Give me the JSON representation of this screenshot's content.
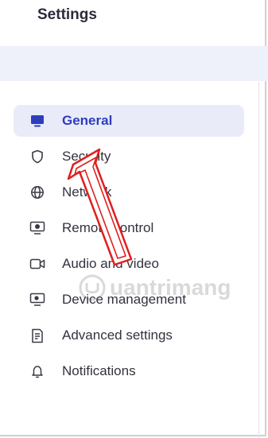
{
  "header": {
    "title": "Settings"
  },
  "sidebar": {
    "items": [
      {
        "label": "General",
        "icon": "monitor-icon",
        "active": true
      },
      {
        "label": "Security",
        "icon": "shield-icon",
        "active": false
      },
      {
        "label": "Network",
        "icon": "globe-icon",
        "active": false
      },
      {
        "label": "Remote control",
        "icon": "remote-screen-icon",
        "active": false
      },
      {
        "label": "Audio and video",
        "icon": "video-camera-icon",
        "active": false
      },
      {
        "label": "Device management",
        "icon": "device-settings-icon",
        "active": false
      },
      {
        "label": "Advanced settings",
        "icon": "document-settings-icon",
        "active": false
      },
      {
        "label": "Notifications",
        "icon": "bell-icon",
        "active": false
      }
    ]
  },
  "colors": {
    "accent": "#2e3dbf",
    "active_bg": "#e9ecf8",
    "band": "#eef0fa",
    "arrow": "#e01e1e"
  },
  "watermark": {
    "text": "uantrimang"
  }
}
